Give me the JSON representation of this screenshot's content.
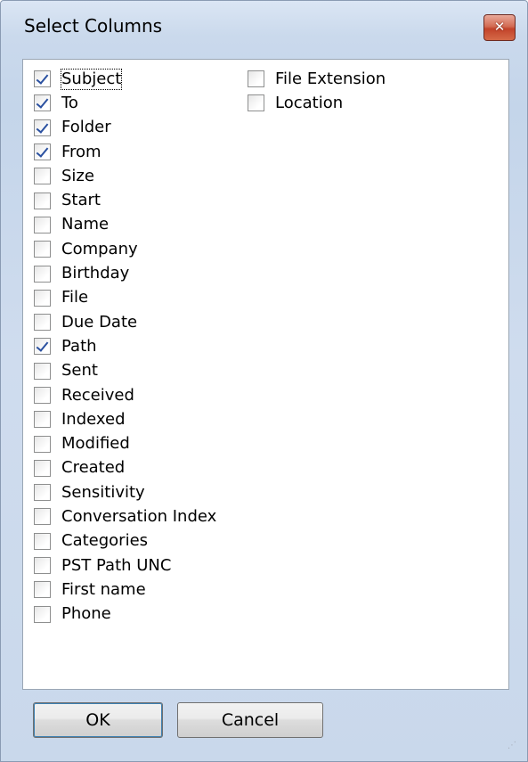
{
  "window": {
    "title": "Select Columns",
    "close_icon": "close-icon"
  },
  "columns": {
    "left": [
      {
        "label": "Subject",
        "checked": true,
        "focused": true
      },
      {
        "label": "To",
        "checked": true
      },
      {
        "label": "Folder",
        "checked": true
      },
      {
        "label": "From",
        "checked": true
      },
      {
        "label": "Size",
        "checked": false
      },
      {
        "label": "Start",
        "checked": false
      },
      {
        "label": "Name",
        "checked": false
      },
      {
        "label": "Company",
        "checked": false
      },
      {
        "label": "Birthday",
        "checked": false
      },
      {
        "label": "File",
        "checked": false
      },
      {
        "label": "Due Date",
        "checked": false
      },
      {
        "label": "Path",
        "checked": true
      },
      {
        "label": "Sent",
        "checked": false
      },
      {
        "label": "Received",
        "checked": false
      },
      {
        "label": "Indexed",
        "checked": false
      },
      {
        "label": "Modified",
        "checked": false
      },
      {
        "label": "Created",
        "checked": false
      },
      {
        "label": "Sensitivity",
        "checked": false
      },
      {
        "label": "Conversation Index",
        "checked": false
      },
      {
        "label": "Categories",
        "checked": false
      },
      {
        "label": "PST Path UNC",
        "checked": false
      },
      {
        "label": "First name",
        "checked": false
      },
      {
        "label": "Phone",
        "checked": false
      }
    ],
    "right": [
      {
        "label": "File Extension",
        "checked": false
      },
      {
        "label": "Location",
        "checked": false
      }
    ]
  },
  "buttons": {
    "ok_label": "OK",
    "cancel_label": "Cancel"
  },
  "colors": {
    "check_mark": "#2a50a0",
    "close_button": "#c2432a"
  }
}
